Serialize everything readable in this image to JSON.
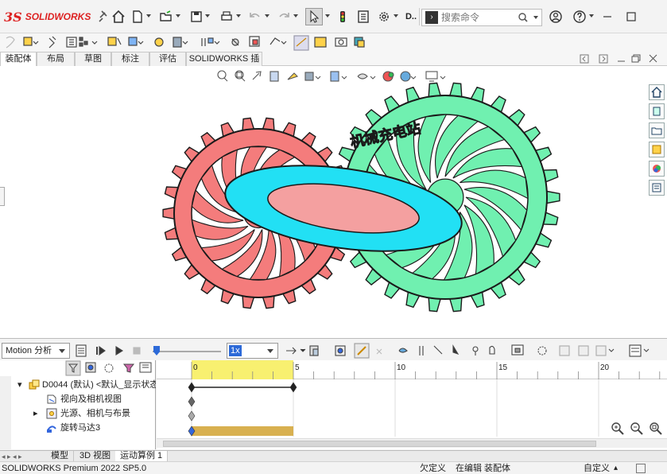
{
  "app": {
    "brand": "SOLIDWORKS",
    "brand_mark": "3S",
    "doc_short": "D.."
  },
  "search": {
    "placeholder": "搜索命令",
    "cmd_icon": "›"
  },
  "window_controls": [
    "minimize",
    "maximize"
  ],
  "command_tabs": [
    {
      "label": "装配体",
      "active": true
    },
    {
      "label": "布局",
      "active": false
    },
    {
      "label": "草图",
      "active": false
    },
    {
      "label": "标注",
      "active": false
    },
    {
      "label": "评估",
      "active": false
    },
    {
      "label": "SOLIDWORKS 插件",
      "active": false
    }
  ],
  "graphics": {
    "watermark_text": "机械充电站",
    "colors": {
      "left_gear": "#f47c7c",
      "right_gear": "#70f0b0",
      "ring": "#22e0f4",
      "outline": "#1a1a1a"
    }
  },
  "motion": {
    "study_type": "Motion 分析",
    "speed": "1x",
    "tree": [
      {
        "label": "D0044 (默认) <默认_显示状态",
        "level": 0,
        "expand": "▾",
        "icon": "assembly-icon"
      },
      {
        "label": "视向及相机视图",
        "level": 1,
        "expand": "",
        "icon": "camera-view-icon"
      },
      {
        "label": "光源、相机与布景",
        "level": 1,
        "expand": "▸",
        "icon": "lights-icon"
      },
      {
        "label": "旋转马达3",
        "level": 1,
        "expand": "",
        "icon": "motor-icon"
      }
    ],
    "timeline": {
      "ticks": [
        {
          "label": "0",
          "t": 0
        },
        {
          "label": "5",
          "t": 5
        },
        {
          "label": "10",
          "t": 10
        },
        {
          "label": "15",
          "t": 15
        },
        {
          "label": "20",
          "t": 20
        }
      ],
      "highlight_end": 5,
      "key_end": 5,
      "motor_bar_end": 5,
      "colors": {
        "highlight": "#f8f070",
        "motor": "#d8b050"
      }
    }
  },
  "bottom_tabs": [
    {
      "label": "模型",
      "active": false
    },
    {
      "label": "3D 视图",
      "active": false
    },
    {
      "label": "运动算例 1",
      "active": true
    }
  ],
  "status": {
    "product": "SOLIDWORKS Premium 2022 SP5.0",
    "constraint": "欠定义",
    "mode": "在编辑 装配体",
    "units": "自定义"
  }
}
